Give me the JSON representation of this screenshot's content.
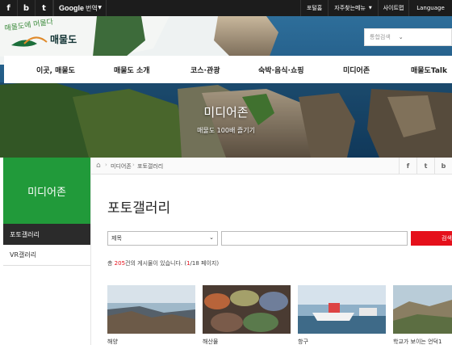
{
  "topbar": {
    "sns": [
      "f",
      "b",
      "t"
    ],
    "translate": {
      "google": "Google",
      "label": "번역"
    },
    "links": [
      "포털홈",
      "자주찾는메뉴",
      "사이트맵",
      "Language"
    ]
  },
  "header": {
    "logo_script": "매물도에 머물다",
    "logo_name": "매물도",
    "search_placeholder": "통합검색"
  },
  "gnb": [
    "이곳, 매물도",
    "매물도 소개",
    "코스·관광",
    "숙박·음식·쇼핑",
    "미디어존",
    "매물도Talk"
  ],
  "hero": {
    "title": "미디어존",
    "subtitle": "매물도 100배 즐기기"
  },
  "sidebar": {
    "title": "미디어존",
    "items": [
      {
        "label": "포토갤러리",
        "active": true
      },
      {
        "label": "VR갤러리",
        "active": false
      }
    ]
  },
  "breadcrumb": [
    "미디어존",
    "포토갤러리"
  ],
  "share": [
    "f",
    "t",
    "b"
  ],
  "page_title": "포토갤러리",
  "search": {
    "select_value": "제목",
    "button": "검색"
  },
  "count": {
    "prefix": "총 ",
    "total": "205",
    "middle": "건의 게시물이 있습니다. (",
    "current": "1",
    "pages": "/18 페이지)"
  },
  "gallery": [
    {
      "caption": "해양"
    },
    {
      "caption": "해산물"
    },
    {
      "caption": "항구"
    },
    {
      "caption": "학교가 보이는 언덕1"
    }
  ],
  "colors": {
    "accent_green": "#219a3a",
    "accent_red": "#e5101b",
    "dark": "#1c1c1c"
  }
}
